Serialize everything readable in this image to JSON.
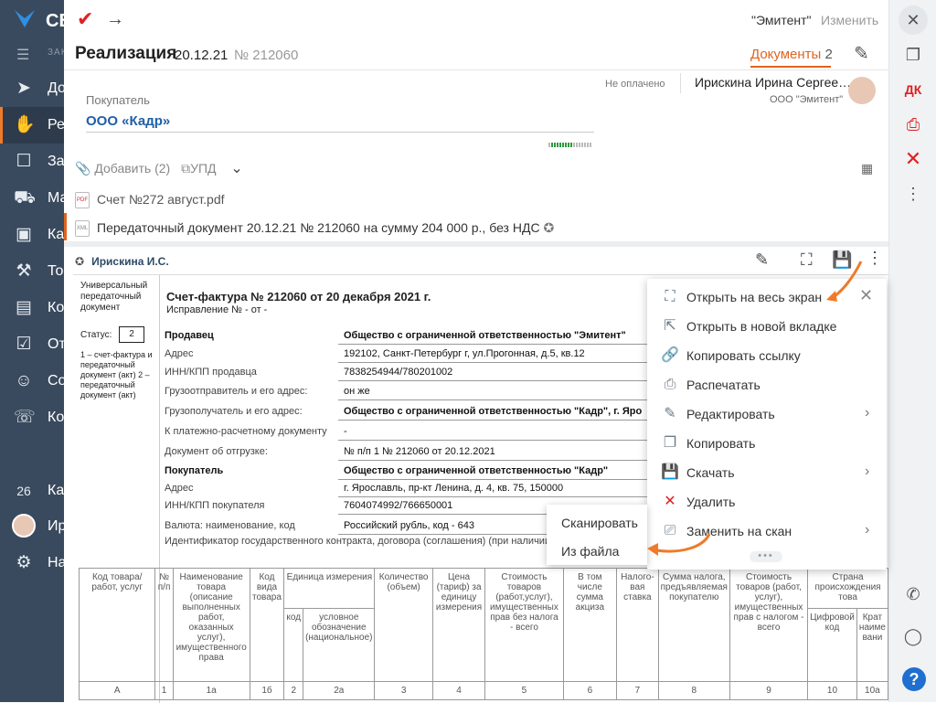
{
  "sidebar": {
    "title": "СБ",
    "subtitle": "ЗАК",
    "items": [
      {
        "icon": "send-icon",
        "label": "До"
      },
      {
        "icon": "hand-coin-icon",
        "label": "Ре"
      },
      {
        "icon": "task-icon",
        "label": "За"
      },
      {
        "icon": "cart-icon",
        "label": "Ма"
      },
      {
        "icon": "box-icon",
        "label": "Ка"
      },
      {
        "icon": "goods-icon",
        "label": "То"
      },
      {
        "icon": "contacts-icon",
        "label": "Ко"
      },
      {
        "icon": "report-icon",
        "label": "От"
      },
      {
        "icon": "people-icon",
        "label": "Со"
      },
      {
        "icon": "chat-icon",
        "label": "Ко"
      },
      {
        "icon": "calendar-icon",
        "label": "Ка"
      },
      {
        "icon": "avatar",
        "label": "Ир"
      },
      {
        "icon": "gear-icon",
        "label": "На"
      }
    ],
    "calendar_day": "26"
  },
  "header": {
    "check_icon": "check-icon",
    "org": "\"Эмитент\"",
    "change": "Изменить",
    "title": "Реализация",
    "date": "20.12.21",
    "number": "№ 212060",
    "docs_tab": "Документы",
    "docs_count": "2"
  },
  "status": {
    "unpaid": "Не оплачено",
    "person": "Ирискина Ирина Сергее…",
    "person_org": "ООО \"Эмитент\""
  },
  "buyer": {
    "label": "Покупатель",
    "value": "ООО «Кадр»"
  },
  "attachments": {
    "add": "Добавить (2)",
    "upd": "УПД",
    "files": [
      {
        "name": "Счет №272 август.pdf",
        "type": "PDF"
      },
      {
        "name": "Передаточный документ 20.12.21 № 212060 на сумму 204 000 р., без НДС",
        "type": "XML"
      }
    ]
  },
  "viewer": {
    "signer": "Ирискина И.С."
  },
  "document": {
    "left_caption": "Универсальный передаточный документ",
    "status_label": "Статус:",
    "status_value": "2",
    "notes": "1 – счет-фактура и передаточный документ (акт) 2 – передаточный документ (акт)",
    "title": "Счет-фактура № 212060 от 20 декабря 2021 г.",
    "correction": "Исправление № - от -",
    "rows": [
      {
        "k": "Продавец",
        "v": "Общество с ограниченной ответственностью \"Эмитент\"",
        "bold": true
      },
      {
        "k": "Адрес",
        "v": "192102, Санкт-Петербург г, ул.Прогонная, д.5, кв.12",
        "bold": false
      },
      {
        "k": "ИНН/КПП продавца",
        "v": "7838254944/780201002",
        "bold": false
      },
      {
        "k": "Грузоотправитель и его адрес:",
        "v": "он же",
        "bold": false
      },
      {
        "k": "Грузополучатель и его адрес:",
        "v": "Общество с ограниченной ответственностью \"Кадр\", г. Яро",
        "bold": false,
        "vbold": true
      },
      {
        "k": "К платежно-расчетному документу",
        "v": "-",
        "bold": false
      },
      {
        "k": "Документ об отгрузке:",
        "v": "№ п/п 1 № 212060 от 20.12.2021",
        "bold": false
      },
      {
        "k": "Покупатель",
        "v": "Общество с ограниченной ответственностью \"Кадр\"",
        "bold": true
      },
      {
        "k": "Адрес",
        "v": "г. Ярославль, пр-кт Ленина, д. 4, кв. 75, 150000",
        "bold": false
      },
      {
        "k": "ИНН/КПП покупателя",
        "v": "7604074992/766650001",
        "bold": false
      },
      {
        "k": "Валюта: наименование, код",
        "v": "Российский рубль, код - 643",
        "bold": false
      }
    ],
    "ident": "Идентификатор государственного контракта, договора (соглашения) (при наличии):",
    "table_headers": [
      "Код товара/ работ, услуг",
      "№ п/п",
      "Наименование товара (описание выполненных работ, оказанных услуг), имущественного права",
      "Код вида товара",
      "Единица измерения",
      "Количество (объем)",
      "Цена (тариф) за единицу измерения",
      "Стоимость товаров (работ,услуг), имущественных прав без налога - всего",
      "В том числе сумма акциза",
      "Налого-вая ставка",
      "Сумма налога, предъявляемая покупателю",
      "Стоимость товаров (работ, услуг), имущественных прав с налогом - всего",
      "Страна происхождения това"
    ],
    "unit_sub": [
      "код",
      "условное обозначение (национальное)"
    ],
    "country_sub": [
      "Цифровой код",
      "Крат наиме вани"
    ],
    "col_nums": [
      "А",
      "1",
      "1а",
      "1б",
      "2",
      "2а",
      "3",
      "4",
      "5",
      "6",
      "7",
      "8",
      "9",
      "10",
      "10а"
    ]
  },
  "context_menu": {
    "items": [
      {
        "icon": "expand-icon",
        "label": "Открыть на весь экран",
        "arrow": false
      },
      {
        "icon": "open-new-tab-icon",
        "label": "Открыть в новой вкладке",
        "arrow": false
      },
      {
        "icon": "link-icon",
        "label": "Копировать ссылку",
        "arrow": false
      },
      {
        "icon": "printer-icon",
        "label": "Распечатать",
        "arrow": false
      },
      {
        "icon": "pencil-icon",
        "label": "Редактировать",
        "arrow": true
      },
      {
        "icon": "copy-icon",
        "label": "Копировать",
        "arrow": false
      },
      {
        "icon": "save-icon",
        "label": "Скачать",
        "arrow": true
      },
      {
        "icon": "delete-icon",
        "label": "Удалить",
        "arrow": false
      },
      {
        "icon": "scan-icon",
        "label": "Заменить на скан",
        "arrow": true
      }
    ]
  },
  "submenu": {
    "items": [
      "Сканировать",
      "Из файла"
    ]
  },
  "rightbar": {
    "dk": "ДК",
    "help": "?"
  },
  "colors": {
    "accent": "#e0641e",
    "sidebar": "#3a4a5e",
    "link": "#1f5ea8",
    "delete": "#d22222"
  }
}
